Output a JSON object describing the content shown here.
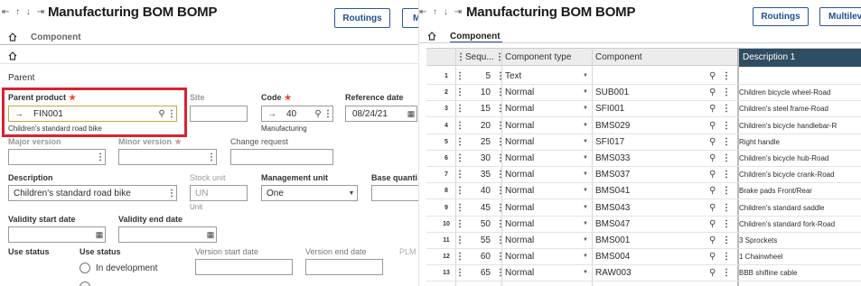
{
  "left": {
    "nav_arrows": "⇤ ↑ ↓ ⇥",
    "title": "Manufacturing BOM BOMP",
    "routings_button": "Routings",
    "cut_button": "M",
    "tab_component": "Component",
    "section_parent": "Parent",
    "parent_product": {
      "label": "Parent product",
      "value": "FIN001",
      "desc": "Children's standard road bike"
    },
    "site": {
      "label": "Site",
      "value": ""
    },
    "code": {
      "label": "Code",
      "value": "40",
      "desc": "Manufacturing"
    },
    "reference_date": {
      "label": "Reference date",
      "value": "08/24/21"
    },
    "major_version": {
      "label": "Major version"
    },
    "minor_version": {
      "label": "Minor version"
    },
    "change_request": {
      "label": "Change request"
    },
    "description": {
      "label": "Description",
      "value": "Children's standard road bike"
    },
    "stock_unit": {
      "label": "Stock unit",
      "value": "UN",
      "desc": "Unit"
    },
    "management_unit": {
      "label": "Management unit",
      "value": "One"
    },
    "base_quantity": {
      "label": "Base quanti"
    },
    "validity_start": {
      "label": "Validity start date"
    },
    "validity_end": {
      "label": "Validity end date"
    },
    "use_status_label": "Use status",
    "use_status_label2": "Use status",
    "use_status_option": "In development",
    "version_start": {
      "label": "Version start date"
    },
    "version_end": {
      "label": "Version end date"
    },
    "plm_label": "PLM"
  },
  "right": {
    "nav_arrows": "⇤ ↑ ↓ ⇥",
    "title": "Manufacturing BOM BOMP",
    "routings_button": "Routings",
    "multilevel_button": "Multilev",
    "tab_component": "Component",
    "columns": {
      "seq": "Sequ...",
      "type": "Component type",
      "component": "Component",
      "description": "Description 1"
    },
    "rows": [
      {
        "n": "1",
        "seq": "5",
        "type": "Text",
        "component": "",
        "description": ""
      },
      {
        "n": "2",
        "seq": "10",
        "type": "Normal",
        "component": "SUB001",
        "description": "Children bicycle wheel-Road"
      },
      {
        "n": "3",
        "seq": "15",
        "type": "Normal",
        "component": "SFI001",
        "description": "Children's steel frame-Road"
      },
      {
        "n": "4",
        "seq": "20",
        "type": "Normal",
        "component": "BMS029",
        "description": "Children's bicycle handlebar-R"
      },
      {
        "n": "5",
        "seq": "25",
        "type": "Normal",
        "component": "SFI017",
        "description": "Right handle"
      },
      {
        "n": "6",
        "seq": "30",
        "type": "Normal",
        "component": "BMS033",
        "description": "Children's bicycle hub-Road"
      },
      {
        "n": "7",
        "seq": "35",
        "type": "Normal",
        "component": "BMS037",
        "description": "Children's bicycle crank-Road"
      },
      {
        "n": "8",
        "seq": "40",
        "type": "Normal",
        "component": "BMS041",
        "description": "Brake pads Front/Rear"
      },
      {
        "n": "9",
        "seq": "45",
        "type": "Normal",
        "component": "BMS043",
        "description": "Children's standard saddle"
      },
      {
        "n": "10",
        "seq": "50",
        "type": "Normal",
        "component": "BMS047",
        "description": "Children's standard fork-Road"
      },
      {
        "n": "11",
        "seq": "55",
        "type": "Normal",
        "component": "BMS001",
        "description": "3 Sprockets"
      },
      {
        "n": "12",
        "seq": "60",
        "type": "Normal",
        "component": "BMS004",
        "description": "1 Chainwheel"
      },
      {
        "n": "13",
        "seq": "65",
        "type": "Normal",
        "component": "RAW003",
        "description": "BBB shifline cable"
      }
    ]
  },
  "icons": {
    "home": "home-icon",
    "search": "search-icon",
    "kebab": "more-vert-icon",
    "calendar": "calendar-icon",
    "dropdown": "chevron-down-icon",
    "arrow": "arrow-right-icon"
  },
  "colors": {
    "accent": "#2a5699",
    "highlight_box": "#d9232e",
    "field_focus": "#c8a642",
    "grid_header_dark": "#2f4d62"
  }
}
